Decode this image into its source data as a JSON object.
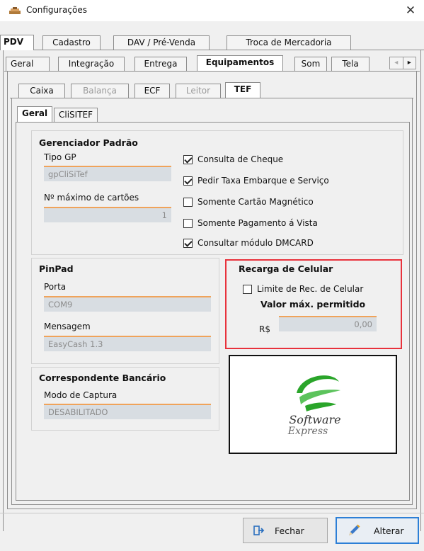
{
  "window": {
    "title": "Configurações",
    "close_glyph": "✕"
  },
  "main_tabs": [
    {
      "label": "PDV",
      "active": true
    },
    {
      "label": "Cadastro"
    },
    {
      "label": "DAV / Pré-Venda"
    },
    {
      "label": "Troca de Mercadoria"
    }
  ],
  "sub_tabs": [
    {
      "label": "Geral"
    },
    {
      "label": "Integração"
    },
    {
      "label": "Entrega"
    },
    {
      "label": "Equipamentos",
      "active": true
    },
    {
      "label": "Som"
    },
    {
      "label": "Tela"
    }
  ],
  "scroll_arrows": {
    "left": "◂",
    "right": "▸"
  },
  "equip_tabs": [
    {
      "label": "Caixa"
    },
    {
      "label": "Balança",
      "disabled": true
    },
    {
      "label": "ECF"
    },
    {
      "label": "Leitor",
      "disabled": true
    },
    {
      "label": "TEF",
      "active": true
    }
  ],
  "tef_tabs": [
    {
      "label": "Geral",
      "active": true
    },
    {
      "label": "CliSITEF"
    }
  ],
  "gerenciador": {
    "title": "Gerenciador Padrão",
    "tipo_gp_label": "Tipo GP",
    "tipo_gp_value": "gpCliSiTef",
    "max_cartoes_label": "Nº máximo de cartões",
    "max_cartoes_value": "1",
    "checkboxes": [
      {
        "label": "Consulta de Cheque",
        "checked": true
      },
      {
        "label": "Pedir Taxa Embarque e Serviço",
        "checked": true
      },
      {
        "label": "Somente Cartão Magnético",
        "checked": false
      },
      {
        "label": "Somente Pagamento á Vista",
        "checked": false
      },
      {
        "label": "Consultar módulo DMCARD",
        "checked": true
      }
    ]
  },
  "pinpad": {
    "title": "PinPad",
    "porta_label": "Porta",
    "porta_value": "COM9",
    "mensagem_label": "Mensagem",
    "mensagem_value": "EasyCash 1.3"
  },
  "recarga": {
    "title": "Recarga de Celular",
    "limite_label": "Limite de Rec. de Celular",
    "limite_checked": false,
    "valor_title": "Valor máx. permitido",
    "currency": "R$",
    "valor_value": "0,00",
    "highlight_color": "#e8323c"
  },
  "correspondente": {
    "title": "Correspondente Bancário",
    "modo_label": "Modo de Captura",
    "modo_value": "DESABILITADO"
  },
  "logo": {
    "line1": "Software",
    "line2": "Express",
    "swoosh_color": "#2aa52a"
  },
  "buttons": {
    "fechar": "Fechar",
    "alterar": "Alterar"
  },
  "colors": {
    "accent_field_border": "#f0a35a",
    "field_bg": "#d8dde2",
    "focus_blue": "#2d7fd6"
  }
}
